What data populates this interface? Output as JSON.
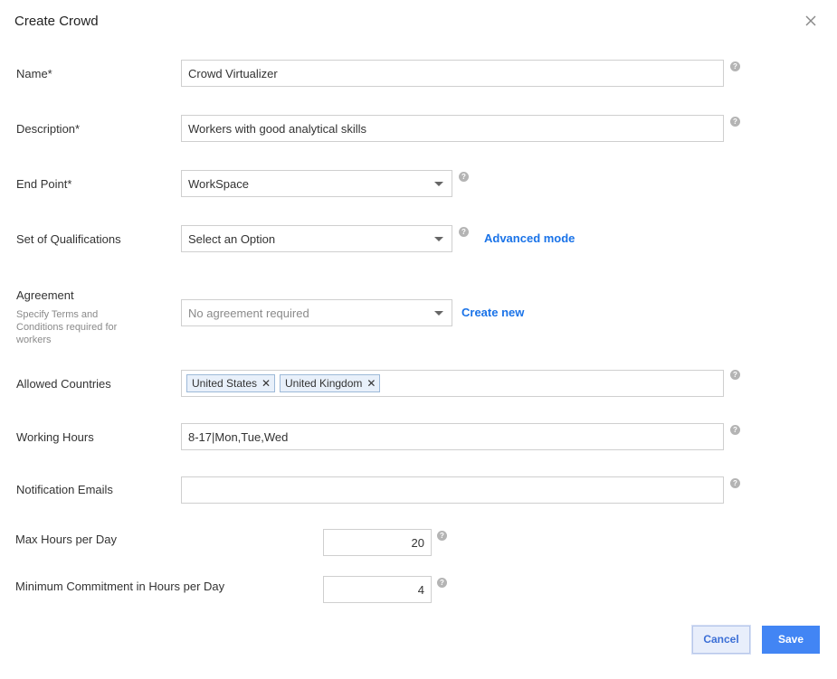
{
  "dialog": {
    "title": "Create Crowd"
  },
  "fields": {
    "name": {
      "label": "Name*",
      "value": "Crowd Virtualizer"
    },
    "description": {
      "label": "Description*",
      "value": "Workers with good analytical skills"
    },
    "end_point": {
      "label": "End Point*",
      "value": "WorkSpace"
    },
    "qualifications": {
      "label": "Set of Qualifications",
      "value": "Select an Option",
      "link": "Advanced mode"
    },
    "agreement": {
      "label": "Agreement",
      "sublabel": "Specify Terms and Conditions required for workers",
      "value": "No agreement required",
      "link": "Create new"
    },
    "countries": {
      "label": "Allowed Countries",
      "tags": [
        "United States",
        "United Kingdom"
      ]
    },
    "working_hours": {
      "label": "Working Hours",
      "value": "8-17|Mon,Tue,Wed"
    },
    "notification_emails": {
      "label": "Notification Emails",
      "value": ""
    },
    "max_hours": {
      "label": "Max Hours per Day",
      "value": "20"
    },
    "min_commitment": {
      "label": "Minimum Commitment in Hours per Day",
      "value": "4"
    }
  },
  "icons": {
    "help": "?",
    "close": "close-icon",
    "remove_tag": "✕"
  },
  "actions": {
    "cancel": "Cancel",
    "save": "Save"
  },
  "colors": {
    "accent": "#4285f4",
    "link": "#1a73e8"
  }
}
